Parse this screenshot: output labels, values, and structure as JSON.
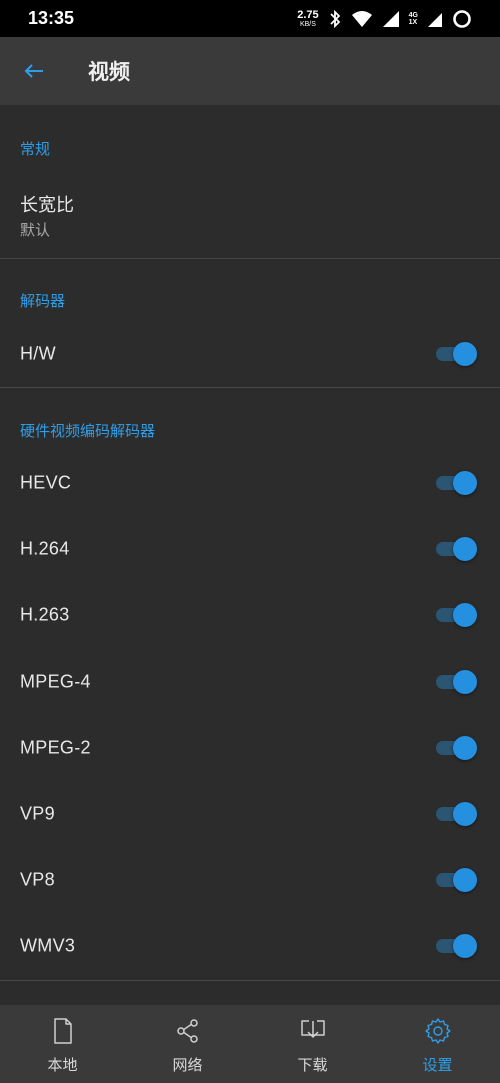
{
  "status_bar": {
    "time": "13:35",
    "net_speed_value": "2.75",
    "net_speed_unit": "KB/S",
    "net_type_top": "4G",
    "net_type_bottom": "1X"
  },
  "header": {
    "title": "视频",
    "back_icon": "arrow-left-icon"
  },
  "sections": {
    "general": {
      "header": "常规",
      "aspect_title": "长宽比",
      "aspect_value": "默认"
    },
    "decoder": {
      "header": "解码器",
      "hw_label": "H/W",
      "hw_enabled": true
    },
    "hw_codecs": {
      "header": "硬件视频编码解码器",
      "items": [
        {
          "label": "HEVC",
          "enabled": true
        },
        {
          "label": "H.264",
          "enabled": true
        },
        {
          "label": "H.263",
          "enabled": true
        },
        {
          "label": "MPEG-4",
          "enabled": true
        },
        {
          "label": "MPEG-2",
          "enabled": true
        },
        {
          "label": "VP9",
          "enabled": true
        },
        {
          "label": "VP8",
          "enabled": true
        },
        {
          "label": "WMV3",
          "enabled": true
        }
      ]
    }
  },
  "bottom_nav": {
    "items": [
      {
        "label": "本地",
        "icon": "file-icon",
        "active": false
      },
      {
        "label": "网络",
        "icon": "share-icon",
        "active": false
      },
      {
        "label": "下载",
        "icon": "download-icon",
        "active": false
      },
      {
        "label": "设置",
        "icon": "gear-icon",
        "active": true
      }
    ]
  },
  "colors": {
    "accent": "#2f9ee8",
    "background": "#2c2c2c",
    "header_bg": "#3a3a3a",
    "toggle_thumb": "#2490df",
    "toggle_track": "#2a5573"
  }
}
